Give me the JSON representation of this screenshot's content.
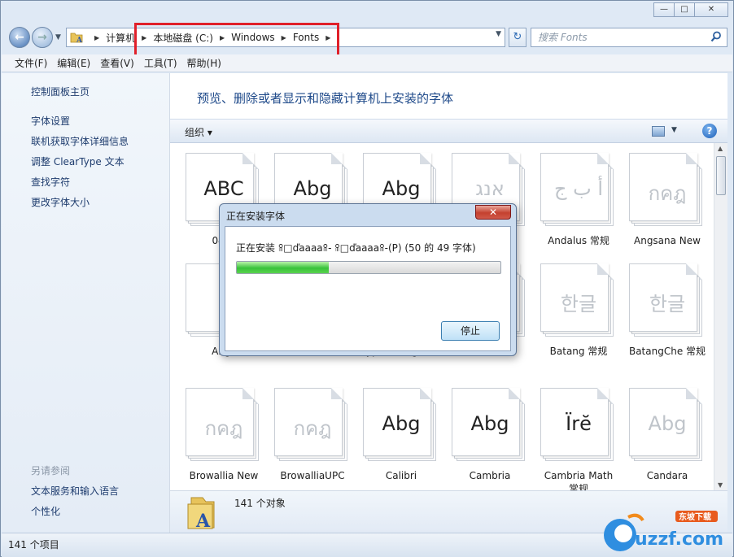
{
  "window": {
    "controls": {
      "minimize": "—",
      "maximize": "□",
      "close": "✕"
    }
  },
  "address": {
    "crumbs": [
      "计算机",
      "本地磁盘 (C:)",
      "Windows",
      "Fonts"
    ],
    "search_placeholder": "搜索 Fonts"
  },
  "menu": [
    "文件(F)",
    "编辑(E)",
    "查看(V)",
    "工具(T)",
    "帮助(H)"
  ],
  "sidebar": {
    "home": "控制面板主页",
    "links": [
      "字体设置",
      "联机获取字体详细信息",
      "调整 ClearType 文本",
      "查找字符",
      "更改字体大小"
    ],
    "see_also_title": "另请参阅",
    "see_also": [
      "文本服务和输入语言",
      "个性化"
    ]
  },
  "content": {
    "header": "预览、删除或者显示和隐藏计算机上安装的字体",
    "organize": "组织 ▾"
  },
  "fonts": [
    {
      "label": "04b_",
      "glyph": "ABC",
      "faint": false
    },
    {
      "label": "",
      "glyph": "Abg",
      "faint": false
    },
    {
      "label": "",
      "glyph": "Abg",
      "faint": false
    },
    {
      "label": "",
      "glyph": "אנג",
      "faint": true
    },
    {
      "label": "Andalus 常规",
      "glyph": "أ ب ج",
      "faint": true
    },
    {
      "label": "Angsana New",
      "glyph": "กคฎ",
      "faint": true
    },
    {
      "label": "Angs",
      "glyph": "",
      "faint": true
    },
    {
      "label": "",
      "glyph": "",
      "faint": true
    },
    {
      "label": "Typesetting 常规",
      "glyph": "",
      "faint": true
    },
    {
      "label": "",
      "glyph": "",
      "faint": true
    },
    {
      "label": "Batang 常规",
      "glyph": "한글",
      "faint": true
    },
    {
      "label": "BatangChe 常规",
      "glyph": "한글",
      "faint": true
    },
    {
      "label": "Browallia New",
      "glyph": "กคฎ",
      "faint": true
    },
    {
      "label": "BrowalliaUPC",
      "glyph": "กคฎ",
      "faint": true
    },
    {
      "label": "Calibri",
      "glyph": "Abg",
      "faint": false
    },
    {
      "label": "Cambria",
      "glyph": "Abg",
      "faint": false
    },
    {
      "label": "Cambria Math 常规",
      "glyph": "Ïrĕ",
      "faint": false
    },
    {
      "label": "Candara",
      "glyph": "Abg",
      "faint": true
    }
  ],
  "details": {
    "count": "141 个对象"
  },
  "status": {
    "items": "141 个项目"
  },
  "dialog": {
    "title": "正在安装字体",
    "message": "正在安装 ꕉ□ďaaaaꕉ- ꕉ□ďaaaaꕉ-(P) (50 的 49 字体)",
    "progress_percent": 35,
    "stop": "停止",
    "close": "✕"
  },
  "watermark": {
    "brand": "uzzf.com",
    "tag": "东坡下载"
  }
}
